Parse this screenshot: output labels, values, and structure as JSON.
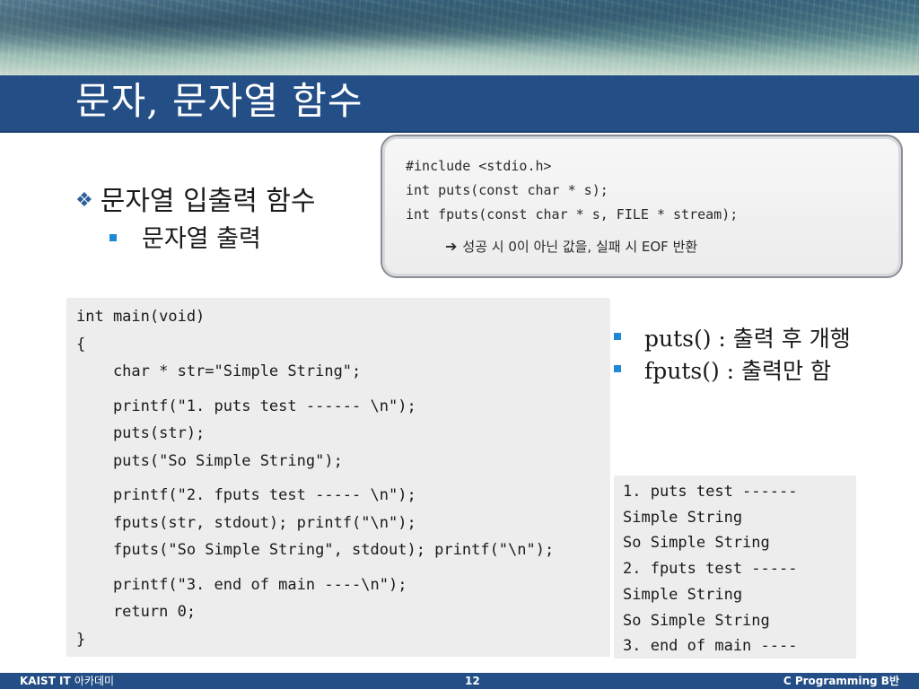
{
  "header": {
    "title": "문자, 문자열 함수"
  },
  "bullets": {
    "level1": "문자열 입출력 함수",
    "level2": "문자열 출력"
  },
  "prototype_box": {
    "lines": [
      "#include <stdio.h>",
      "int puts(const char * s);",
      "int fputs(const char * s, FILE * stream);"
    ],
    "note": "성공 시 0이 아닌 값을, 실패 시 EOF 반환",
    "icon": "arrow-right-icon"
  },
  "code": {
    "lines": [
      "int main(void)",
      "{",
      "    char * str=\"Simple String\";",
      "",
      "    printf(\"1. puts test ------ \\n\");",
      "    puts(str);",
      "    puts(\"So Simple String\");",
      "",
      "    printf(\"2. fputs test ----- \\n\");",
      "    fputs(str, stdout); printf(\"\\n\");",
      "    fputs(\"So Simple String\", stdout); printf(\"\\n\");",
      "",
      "    printf(\"3. end of main ----\\n\");",
      "    return 0;",
      "}"
    ]
  },
  "right_bullets": [
    "puts() : 출력 후 개행",
    "fputs() : 출력만 함"
  ],
  "output": {
    "lines": [
      "1. puts test ------",
      "Simple String",
      "So Simple String",
      "2. fputs test -----",
      "Simple String",
      "So Simple String",
      "3. end of main ----"
    ]
  },
  "footer": {
    "left_bold": "KAIST IT",
    "left_thin": "아카데미",
    "page": "12",
    "right": "C Programming B반"
  },
  "colors": {
    "title_bar": "#234e86",
    "bullet_square": "#1e88d6",
    "diamond": "#2f5f9a",
    "code_bg": "#ededed"
  }
}
